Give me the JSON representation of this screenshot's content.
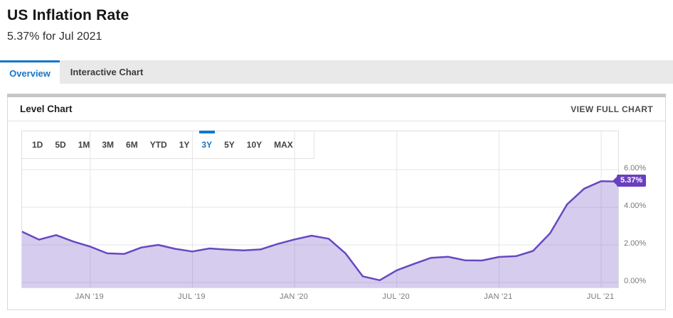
{
  "page": {
    "title": "US Inflation Rate",
    "subtitle": "5.37% for Jul 2021"
  },
  "tabs": [
    {
      "label": "Overview",
      "active": true
    },
    {
      "label": "Interactive Chart",
      "active": false
    }
  ],
  "card": {
    "title": "Level Chart",
    "action": "VIEW FULL CHART"
  },
  "range_selector": {
    "options": [
      "1D",
      "5D",
      "1M",
      "3M",
      "6M",
      "YTD",
      "1Y",
      "3Y",
      "5Y",
      "10Y",
      "MAX"
    ],
    "active": "3Y"
  },
  "chart_data": {
    "type": "area",
    "title": "US Inflation Rate - Level Chart (3Y)",
    "unit": "%",
    "x": [
      "Aug 2018",
      "Sep 2018",
      "Oct 2018",
      "Nov 2018",
      "Dec 2018",
      "Jan 2019",
      "Feb 2019",
      "Mar 2019",
      "Apr 2019",
      "May 2019",
      "Jun 2019",
      "Jul 2019",
      "Aug 2019",
      "Sep 2019",
      "Oct 2019",
      "Nov 2019",
      "Dec 2019",
      "Jan 2020",
      "Feb 2020",
      "Mar 2020",
      "Apr 2020",
      "May 2020",
      "Jun 2020",
      "Jul 2020",
      "Aug 2020",
      "Sep 2020",
      "Oct 2020",
      "Nov 2020",
      "Dec 2020",
      "Jan 2021",
      "Feb 2021",
      "Mar 2021",
      "Apr 2021",
      "May 2021",
      "Jun 2021",
      "Jul 2021"
    ],
    "values": [
      2.7,
      2.28,
      2.52,
      2.18,
      1.91,
      1.55,
      1.52,
      1.86,
      2.0,
      1.79,
      1.65,
      1.81,
      1.75,
      1.71,
      1.76,
      2.05,
      2.29,
      2.49,
      2.33,
      1.54,
      0.33,
      0.12,
      0.65,
      0.99,
      1.31,
      1.37,
      1.18,
      1.17,
      1.36,
      1.4,
      1.68,
      2.62,
      4.16,
      4.99,
      5.39,
      5.37
    ],
    "ylim": [
      -0.25,
      8.05
    ],
    "grid": true,
    "legend_position": "none",
    "y_ticks": [
      {
        "value": 6,
        "label": "6.00%"
      },
      {
        "value": 4,
        "label": "4.00%"
      },
      {
        "value": 2,
        "label": "2.00%"
      },
      {
        "value": 0,
        "label": "0.00%"
      }
    ],
    "x_ticks": [
      {
        "index": 4,
        "label": "JAN '19"
      },
      {
        "index": 10,
        "label": "JUL '19"
      },
      {
        "index": 16,
        "label": "JAN '20"
      },
      {
        "index": 22,
        "label": "JUL '20"
      },
      {
        "index": 28,
        "label": "JAN '21"
      },
      {
        "index": 34,
        "label": "JUL '21"
      }
    ],
    "last_value_label": "5.37%",
    "colors": {
      "line": "#6748c2",
      "fill": "rgba(103,72,194,0.27)",
      "badge": "#6a3fbf",
      "accent": "#1577c8",
      "gridline": "#e5e5e5"
    }
  }
}
